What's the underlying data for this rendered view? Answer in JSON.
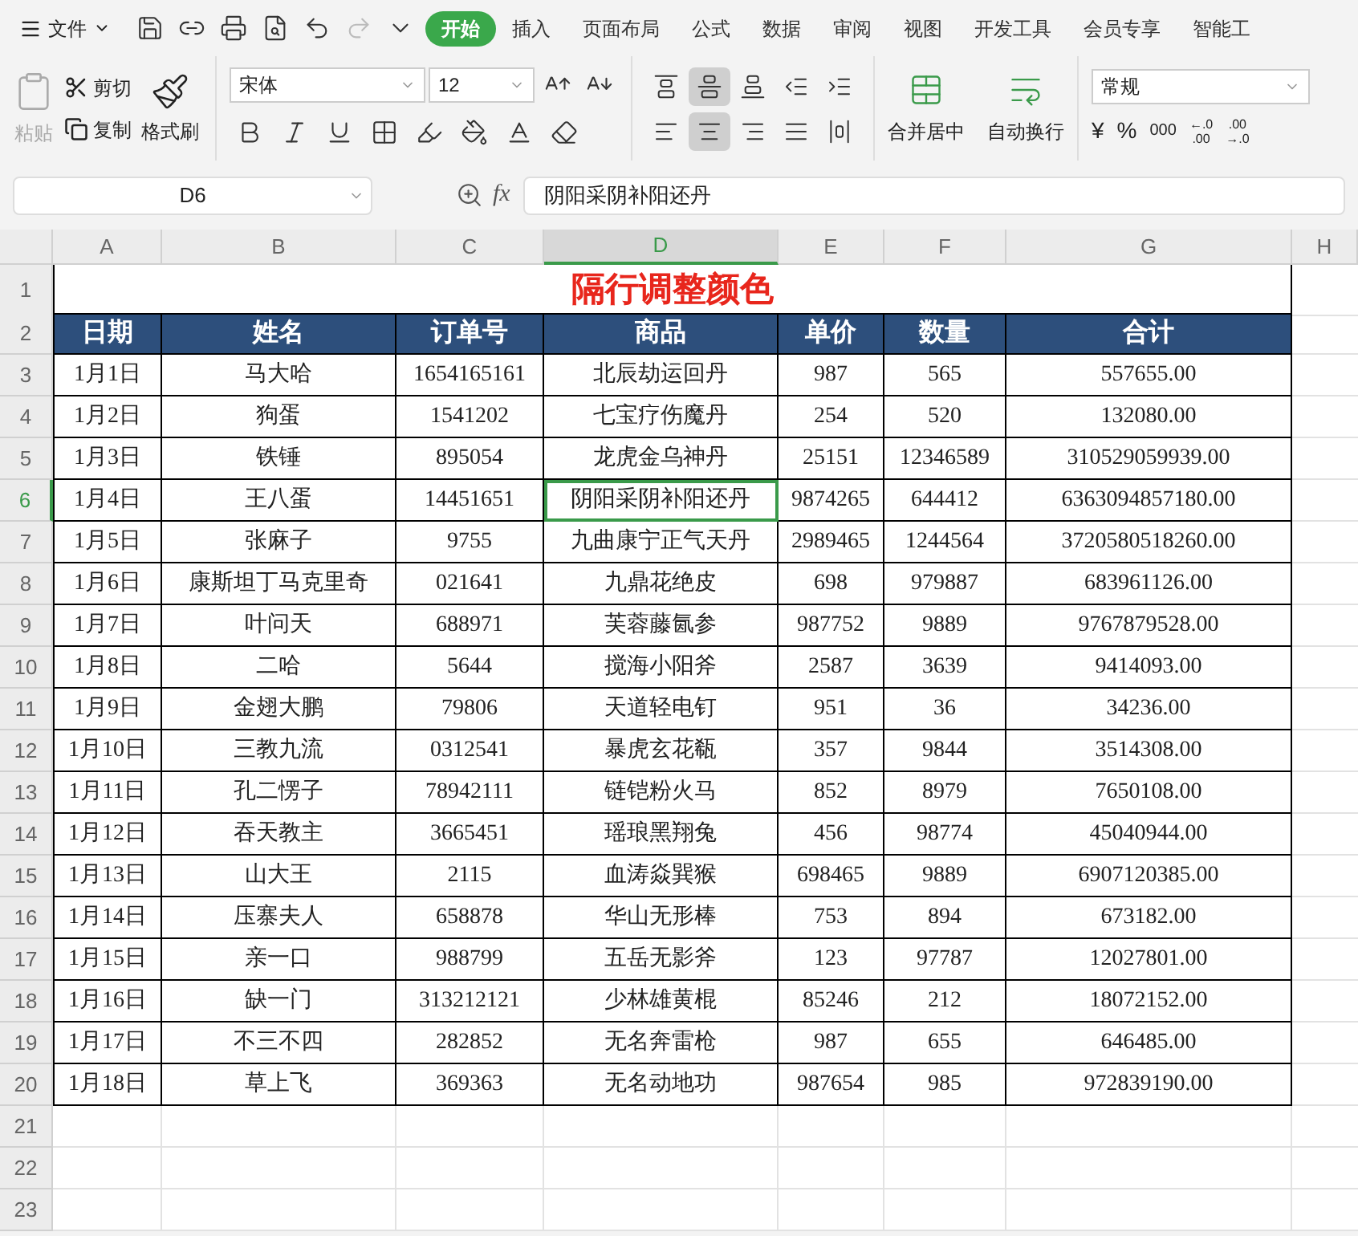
{
  "menu": {
    "file": "文件",
    "tabs": [
      {
        "label": "开始",
        "selected": true
      },
      {
        "label": "插入",
        "selected": false
      },
      {
        "label": "页面布局",
        "selected": false
      },
      {
        "label": "公式",
        "selected": false
      },
      {
        "label": "数据",
        "selected": false
      },
      {
        "label": "审阅",
        "selected": false
      },
      {
        "label": "视图",
        "selected": false
      },
      {
        "label": "开发工具",
        "selected": false
      },
      {
        "label": "会员专享",
        "selected": false
      },
      {
        "label": "智能工",
        "selected": false
      }
    ]
  },
  "ribbon": {
    "paste": {
      "label": "粘贴",
      "disabled": true
    },
    "cut": "剪切",
    "copy": "复制",
    "format_painter": "格式刷",
    "font": "宋体",
    "font_size": "12",
    "align_top": [
      {
        "kind": "top",
        "selected": false
      },
      {
        "kind": "middle",
        "selected": true
      },
      {
        "kind": "bottom",
        "selected": false
      },
      {
        "kind": "outdent",
        "selected": false
      },
      {
        "kind": "indent",
        "selected": false
      }
    ],
    "align_bottom": [
      {
        "kind": "left",
        "selected": false
      },
      {
        "kind": "center",
        "selected": true
      },
      {
        "kind": "right",
        "selected": false
      },
      {
        "kind": "justify",
        "selected": false
      },
      {
        "kind": "distribute",
        "selected": false
      }
    ],
    "merge": "合并居中",
    "wrap": "自动换行",
    "number_format": "常规",
    "currency": "¥",
    "percent": "%",
    "thousands": "000",
    "decimals": [
      {
        "top": "←.0",
        "bottom": ".00"
      },
      {
        "top": ".00",
        "bottom": "→.0"
      }
    ]
  },
  "formula_bar": {
    "name_box": "D6",
    "fx": "fx",
    "formula": "阴阳采阴补阳还丹"
  },
  "columns": [
    {
      "label": "A",
      "selected": false
    },
    {
      "label": "B",
      "selected": false
    },
    {
      "label": "C",
      "selected": false
    },
    {
      "label": "D",
      "selected": true
    },
    {
      "label": "E",
      "selected": false
    },
    {
      "label": "F",
      "selected": false
    },
    {
      "label": "G",
      "selected": false
    },
    {
      "label": "H",
      "selected": false
    }
  ],
  "row_headers": [
    {
      "label": "1",
      "selected": false
    },
    {
      "label": "2",
      "selected": false
    },
    {
      "label": "3",
      "selected": false
    },
    {
      "label": "4",
      "selected": false
    },
    {
      "label": "5",
      "selected": false
    },
    {
      "label": "6",
      "selected": true
    },
    {
      "label": "7",
      "selected": false
    },
    {
      "label": "8",
      "selected": false
    },
    {
      "label": "9",
      "selected": false
    },
    {
      "label": "10",
      "selected": false
    },
    {
      "label": "11",
      "selected": false
    },
    {
      "label": "12",
      "selected": false
    },
    {
      "label": "13",
      "selected": false
    },
    {
      "label": "14",
      "selected": false
    },
    {
      "label": "15",
      "selected": false
    },
    {
      "label": "16",
      "selected": false
    },
    {
      "label": "17",
      "selected": false
    },
    {
      "label": "18",
      "selected": false
    },
    {
      "label": "19",
      "selected": false
    },
    {
      "label": "20",
      "selected": false
    },
    {
      "label": "21",
      "selected": false
    },
    {
      "label": "22",
      "selected": false
    },
    {
      "label": "23",
      "selected": false
    }
  ],
  "sheet": {
    "title": "隔行调整颜色",
    "headers": [
      "日期",
      "姓名",
      "订单号",
      "商品",
      "单价",
      "数量",
      "合计"
    ],
    "rows": [
      [
        "1月1日",
        "马大哈",
        "1654165161",
        "北辰劫运回丹",
        "987",
        "565",
        "557655.00"
      ],
      [
        "1月2日",
        "狗蛋",
        "1541202",
        "七宝疗伤魔丹",
        "254",
        "520",
        "132080.00"
      ],
      [
        "1月3日",
        "铁锤",
        "895054",
        "龙虎金乌神丹",
        "25151",
        "12346589",
        "310529059939.00"
      ],
      [
        "1月4日",
        "王八蛋",
        "14451651",
        "阴阳采阴补阳还丹",
        "9874265",
        "644412",
        "6363094857180.00"
      ],
      [
        "1月5日",
        "张麻子",
        "9755",
        "九曲康宁正气天丹",
        "2989465",
        "1244564",
        "3720580518260.00"
      ],
      [
        "1月6日",
        "康斯坦丁马克里奇",
        "021641",
        "九鼎花绝皮",
        "698",
        "979887",
        "683961126.00"
      ],
      [
        "1月7日",
        "叶问天",
        "688971",
        "芙蓉藤氤参",
        "987752",
        "9889",
        "9767879528.00"
      ],
      [
        "1月8日",
        "二哈",
        "5644",
        "搅海小阳斧",
        "2587",
        "3639",
        "9414093.00"
      ],
      [
        "1月9日",
        "金翅大鹏",
        "79806",
        "天道轻电钉",
        "951",
        "36",
        "34236.00"
      ],
      [
        "1月10日",
        "三教九流",
        "0312541",
        "暴虎玄花瓻",
        "357",
        "9844",
        "3514308.00"
      ],
      [
        "1月11日",
        "孔二愣子",
        "78942111",
        "链铠粉火马",
        "852",
        "8979",
        "7650108.00"
      ],
      [
        "1月12日",
        "吞天教主",
        "3665451",
        "瑶琅黑翔兔",
        "456",
        "98774",
        "45040944.00"
      ],
      [
        "1月13日",
        "山大王",
        "2115",
        "血涛焱巽猴",
        "698465",
        "9889",
        "6907120385.00"
      ],
      [
        "1月14日",
        "压寨夫人",
        "658878",
        "华山无形棒",
        "753",
        "894",
        "673182.00"
      ],
      [
        "1月15日",
        "亲一口",
        "988799",
        "五岳无影斧",
        "123",
        "97787",
        "12027801.00"
      ],
      [
        "1月16日",
        "缺一门",
        "313212121",
        "少林雄黄棍",
        "85246",
        "212",
        "18072152.00"
      ],
      [
        "1月17日",
        "不三不四",
        "282852",
        "无名奔雷枪",
        "987",
        "655",
        "646485.00"
      ],
      [
        "1月18日",
        "草上飞",
        "369363",
        "无名动地功",
        "987654",
        "985",
        "972839190.00"
      ]
    ]
  }
}
